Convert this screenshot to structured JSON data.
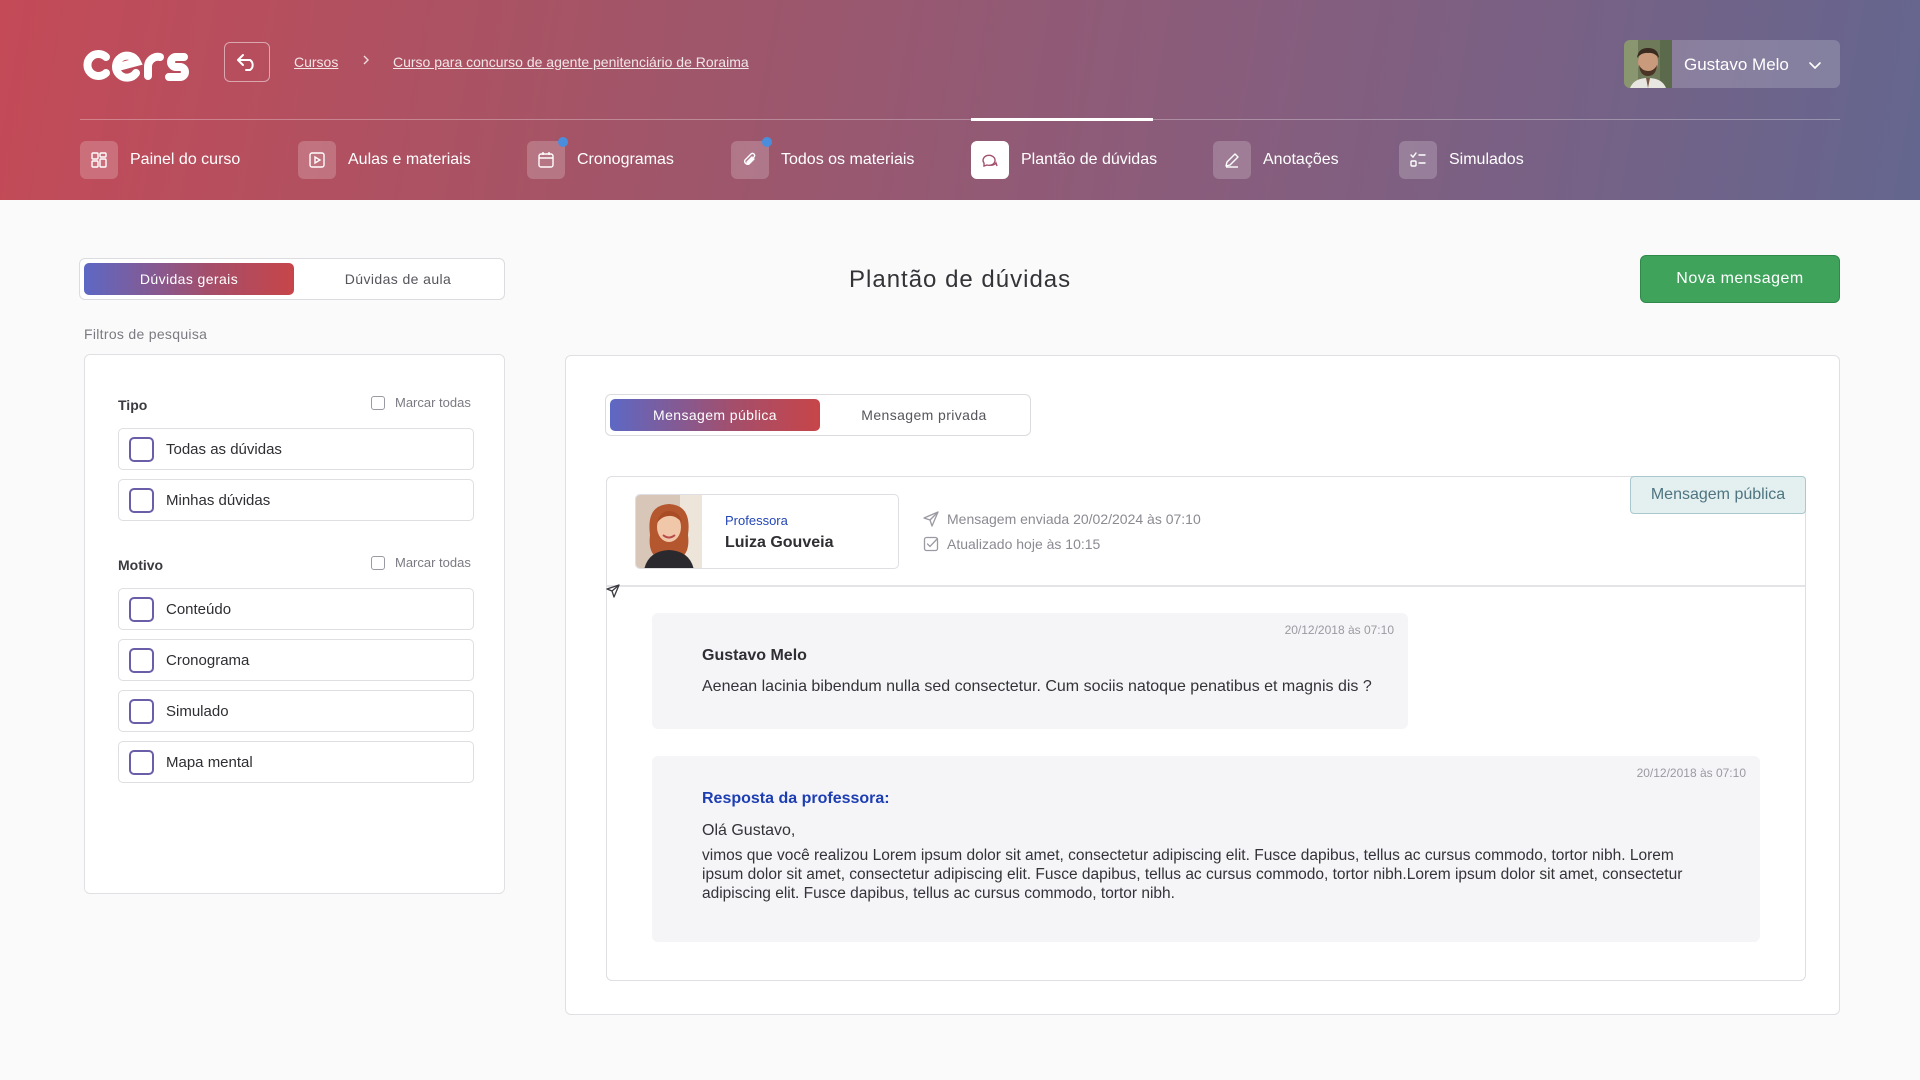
{
  "app": {
    "logo_text": "cers"
  },
  "breadcrumb": {
    "items": [
      "Cursos",
      "Curso para concurso de agente penitenciário de Roraima"
    ],
    "separator": ">"
  },
  "user": {
    "name": "Gustavo Melo",
    "icon": "chevron-down-icon"
  },
  "nav": {
    "items": [
      {
        "label": "Painel do curso",
        "icon": "dashboard-grid-icon",
        "notification_dot": false,
        "active": false
      },
      {
        "label": "Aulas e materiais",
        "icon": "play-square-icon",
        "notification_dot": false,
        "active": false
      },
      {
        "label": "Cronogramas",
        "icon": "calendar-icon",
        "notification_dot": true,
        "active": false
      },
      {
        "label": "Todos os materiais",
        "icon": "paperclip-icon",
        "notification_dot": true,
        "active": false
      },
      {
        "label": "Plantão de dúvidas",
        "icon": "chat-bubbles-icon",
        "notification_dot": false,
        "active": true
      },
      {
        "label": "Anotações",
        "icon": "pencil-icon",
        "notification_dot": false,
        "active": false
      },
      {
        "label": "Simulados",
        "icon": "checklist-icon",
        "notification_dot": false,
        "active": false
      }
    ]
  },
  "left": {
    "tabs": [
      {
        "label": "Dúvidas gerais",
        "active": true
      },
      {
        "label": "Dúvidas de aula",
        "active": false
      }
    ],
    "filters_caption": "Filtros de pesquisa",
    "groups": [
      {
        "title": "Tipo",
        "mark_all": "Marcar todas",
        "options": [
          "Todas as dúvidas",
          "Minhas dúvidas"
        ]
      },
      {
        "title": "Motivo",
        "mark_all": "Marcar todas",
        "options": [
          "Conteúdo",
          "Cronograma",
          "Simulado",
          "Mapa mental"
        ]
      }
    ]
  },
  "page": {
    "title": "Plantão de dúvidas",
    "new_message_label": "Nova mensagem"
  },
  "main": {
    "tabs": [
      {
        "label": "Mensagem pública",
        "active": true
      },
      {
        "label": "Mensagem privada",
        "active": false
      }
    ],
    "thread": {
      "badge": "Mensagem pública",
      "professor": {
        "role": "Professora",
        "name": "Luiza Gouveia"
      },
      "sent_at": "Mensagem enviada 20/02/2024 às 07:10",
      "updated_at": "Atualizado hoje às 10:15",
      "messages": [
        {
          "time": "20/12/2018 às 07:10",
          "author": "Gustavo Melo",
          "text": "Aenean lacinia bibendum nulla sed consectetur. Cum sociis natoque penatibus et magnis dis ?"
        }
      ],
      "response": {
        "time": "20/12/2018 às 07:10",
        "title": "Resposta da professora:",
        "greeting": "Olá Gustavo,",
        "body": "vimos que você realizou Lorem ipsum dolor sit amet, consectetur adipiscing elit. Fusce dapibus, tellus ac cursus commodo, tortor nibh. Lorem ipsum dolor sit amet, consectetur adipiscing elit. Fusce dapibus, tellus ac cursus commodo, tortor nibh.Lorem ipsum dolor sit amet, consectetur adipiscing elit. Fusce dapibus, tellus ac cursus commodo, tortor nibh."
      }
    }
  },
  "colors": {
    "header_gradient_start": "#c44a57",
    "header_gradient_end": "#64668f",
    "primary_green": "#3fa35c",
    "link_blue": "#1d3eb3",
    "checkbox_purple": "#6a5ea8",
    "notification_blue": "#4a8ddc"
  }
}
